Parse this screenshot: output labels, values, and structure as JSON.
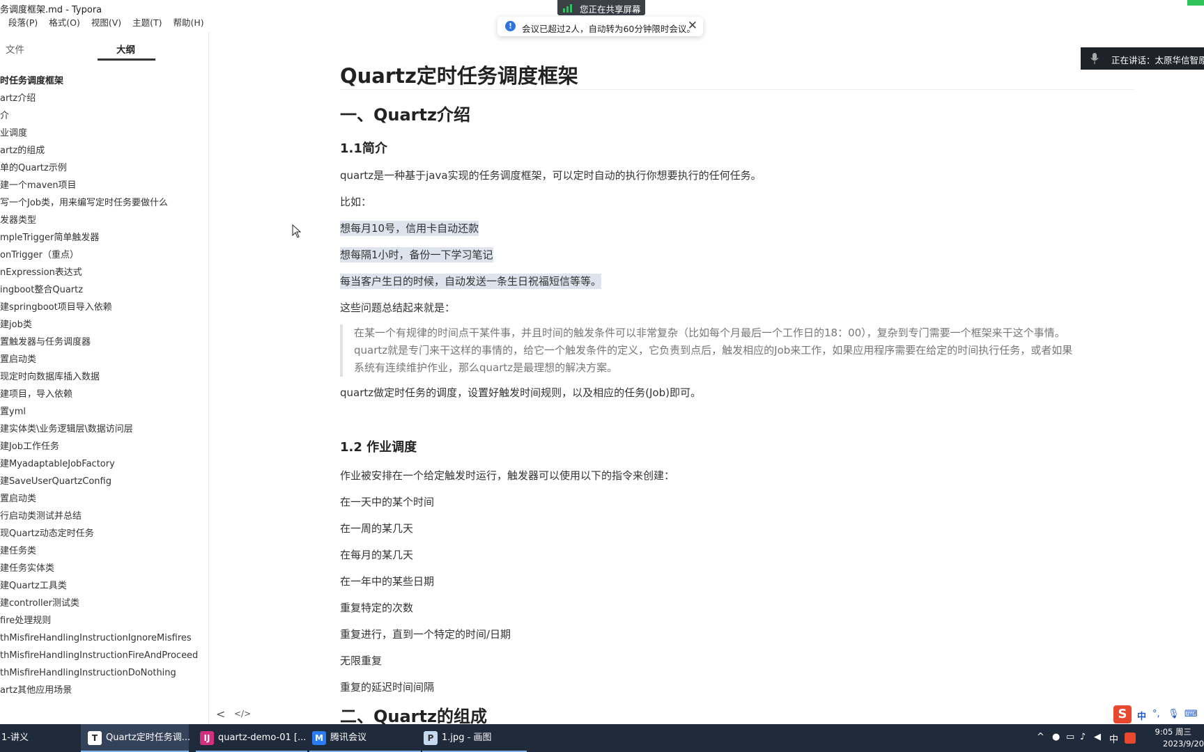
{
  "window": {
    "title": "务调度框架.md - Typora"
  },
  "menu": [
    "段落(P)",
    "格式(O)",
    "视图(V)",
    "主题(T)",
    "帮助(H)"
  ],
  "sidebar": {
    "tab_files": "文件",
    "tab_outline": "大纲",
    "outline": [
      {
        "label": "时任务调度框架",
        "level": 1
      },
      {
        "label": "artz介绍",
        "level": 2
      },
      {
        "label": "介",
        "level": 3
      },
      {
        "label": "业调度",
        "level": 3
      },
      {
        "label": "artz的组成",
        "level": 2
      },
      {
        "label": "单的Quartz示例",
        "level": 2
      },
      {
        "label": "建一个maven项目",
        "level": 3
      },
      {
        "label": "写一个Job类，用来编写定时任务要做什么",
        "level": 3
      },
      {
        "label": "发器类型",
        "level": 2
      },
      {
        "label": "mpleTrigger简单触发器",
        "level": 3
      },
      {
        "label": "onTrigger（重点）",
        "level": 3
      },
      {
        "label": "nExpression表达式",
        "level": 3
      },
      {
        "label": "ingboot整合Quartz",
        "level": 2
      },
      {
        "label": "建springboot项目导入依赖",
        "level": 3
      },
      {
        "label": "建job类",
        "level": 3
      },
      {
        "label": "置触发器与任务调度器",
        "level": 3
      },
      {
        "label": "置启动类",
        "level": 3
      },
      {
        "label": "现定时向数据库插入数据",
        "level": 2
      },
      {
        "label": "建项目，导入依赖",
        "level": 3
      },
      {
        "label": "置yml",
        "level": 3
      },
      {
        "label": "建实体类\\业务逻辑层\\数据访问层",
        "level": 3
      },
      {
        "label": "建Job工作任务",
        "level": 3
      },
      {
        "label": "建MyadaptableJobFactory",
        "level": 3
      },
      {
        "label": "建SaveUserQuartzConfig",
        "level": 3
      },
      {
        "label": "置启动类",
        "level": 3
      },
      {
        "label": "行启动类测试并总结",
        "level": 3
      },
      {
        "label": "现Quartz动态定时任务",
        "level": 2
      },
      {
        "label": "建任务类",
        "level": 3
      },
      {
        "label": "建任务实体类",
        "level": 3
      },
      {
        "label": "建Quartz工具类",
        "level": 3
      },
      {
        "label": "建controller测试类",
        "level": 3
      },
      {
        "label": "fire处理规则",
        "level": 2
      },
      {
        "label": "thMisfireHandlingInstructionIgnoreMisfires",
        "level": 3
      },
      {
        "label": "thMisfireHandlingInstructionFireAndProceed",
        "level": 3
      },
      {
        "label": "thMisfireHandlingInstructionDoNothing",
        "level": 3
      },
      {
        "label": "artz其他应用场景",
        "level": 2
      }
    ],
    "back_icon": "<",
    "source_icon": "</>"
  },
  "doc": {
    "h1": "Quartz定时任务调度框架",
    "h2_intro": "一、Quartz介绍",
    "h3_brief": "1.1简介",
    "p_intro": "quartz是一种基于java实现的任务调度框架，可以定时自动的执行你想要执行的任何任务。",
    "p_example": "比如：",
    "hl1": "想每月10号，信用卡自动还款",
    "hl2": "想每隔1小时，备份一下学习笔记",
    "hl3": "每当客户生日的时候，自动发送一条生日祝福短信等等。",
    "p_summary": "这些问题总结起来就是：",
    "quote1": "在某一个有规律的时间点干某件事，并且时间的触发条件可以非常复杂（比如每个月最后一个工作日的18：00），复杂到专门需要一个框架来干这个事情。",
    "quote2": "quartz就是专门来干这样的事情的，给它一个触发条件的定义，它负责到点后，触发相应的Job来工作，如果应用程序需要在给定的时间执行任务，或者如果",
    "quote3": "系统有连续维护作业，那么quartz是最理想的解决方案。",
    "p_config": "quartz做定时任务的调度，设置好触发时间规则，以及相应的任务(Job)即可。",
    "h3_job": "1.2 作业调度",
    "p_job": "作业被安排在一个给定触发时运行，触发器可以使用以下的指令来创建：",
    "job_items": [
      "在一天中的某个时间",
      "在一周的某几天",
      "在每月的某几天",
      "在一年中的某些日期",
      "重复特定的次数",
      "重复进行，直到一个特定的时间/日期",
      "无限重复",
      "重复的延迟时间间隔"
    ],
    "h2_compose": "二、Quartz的组成"
  },
  "overlay": {
    "share_banner": "您正在共享屏幕",
    "toast": "会议已超过2人，自动转为60分钟限时会议。",
    "toast_close": "✕",
    "speaking": "正在讲话：太原华信智原"
  },
  "ime": {
    "logo": "S",
    "lang": "中",
    "punct": "°,",
    "mic": "🎙",
    "kbd": "⌨"
  },
  "taskbar": {
    "items": [
      "1-讲义",
      "Quartz定时任务调...",
      "quartz-demo-01 [...",
      "腾讯会议",
      "1.jpg - 画图"
    ],
    "tray_lang": "中",
    "time": "9:05 周三",
    "date": "2023/9/20"
  },
  "colors": {
    "accent": "#2f73e0",
    "taskbar": "#1f2a3a",
    "highlight": "#dde4ee",
    "ime": "#e8482e"
  }
}
